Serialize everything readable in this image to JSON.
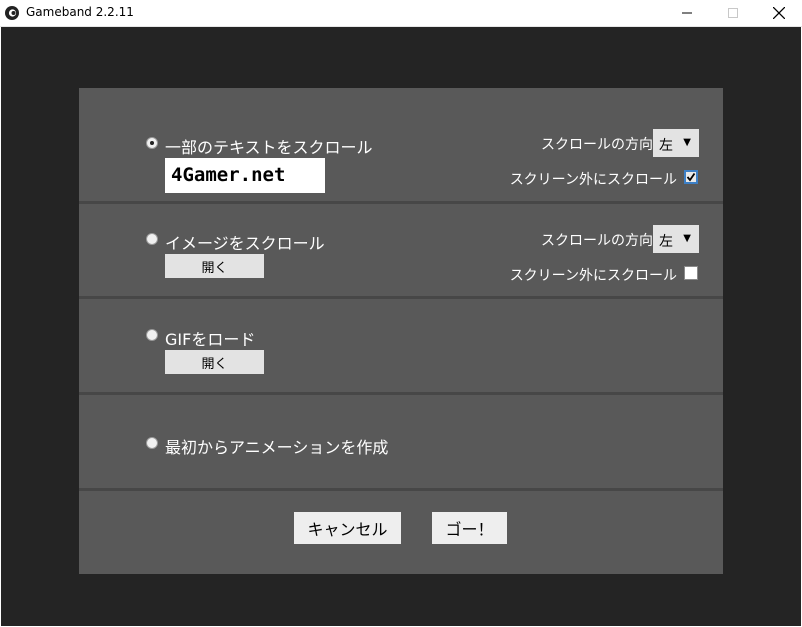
{
  "window": {
    "title": "Gameband 2.2.11",
    "icon": "gameband-logo-icon",
    "controls": {
      "minimize": "minimize-icon",
      "maximize": "maximize-icon",
      "close": "close-icon"
    }
  },
  "options": {
    "scroll_text": {
      "label": "一部のテキストをスクロール",
      "selected": true,
      "text_value": "4Gamer.net",
      "direction_label": "スクロールの方向",
      "direction_value": "左",
      "offscreen_label": "スクリーン外にスクロール",
      "offscreen_checked": true
    },
    "scroll_image": {
      "label": "イメージをスクロール",
      "selected": false,
      "open_label": "開く",
      "direction_label": "スクロールの方向",
      "direction_value": "左",
      "offscreen_label": "スクリーン外にスクロール",
      "offscreen_checked": false
    },
    "load_gif": {
      "label": "GIFをロード",
      "selected": false,
      "open_label": "開く"
    },
    "create_animation": {
      "label": "最初からアニメーションを作成",
      "selected": false
    }
  },
  "actions": {
    "cancel_label": "キャンセル",
    "go_label": "ゴー！"
  },
  "colors": {
    "background": "#242424",
    "panel": "#595959",
    "divider": "#474747",
    "text": "#ffffff",
    "checkbox_accent": "#3c7fc6"
  }
}
